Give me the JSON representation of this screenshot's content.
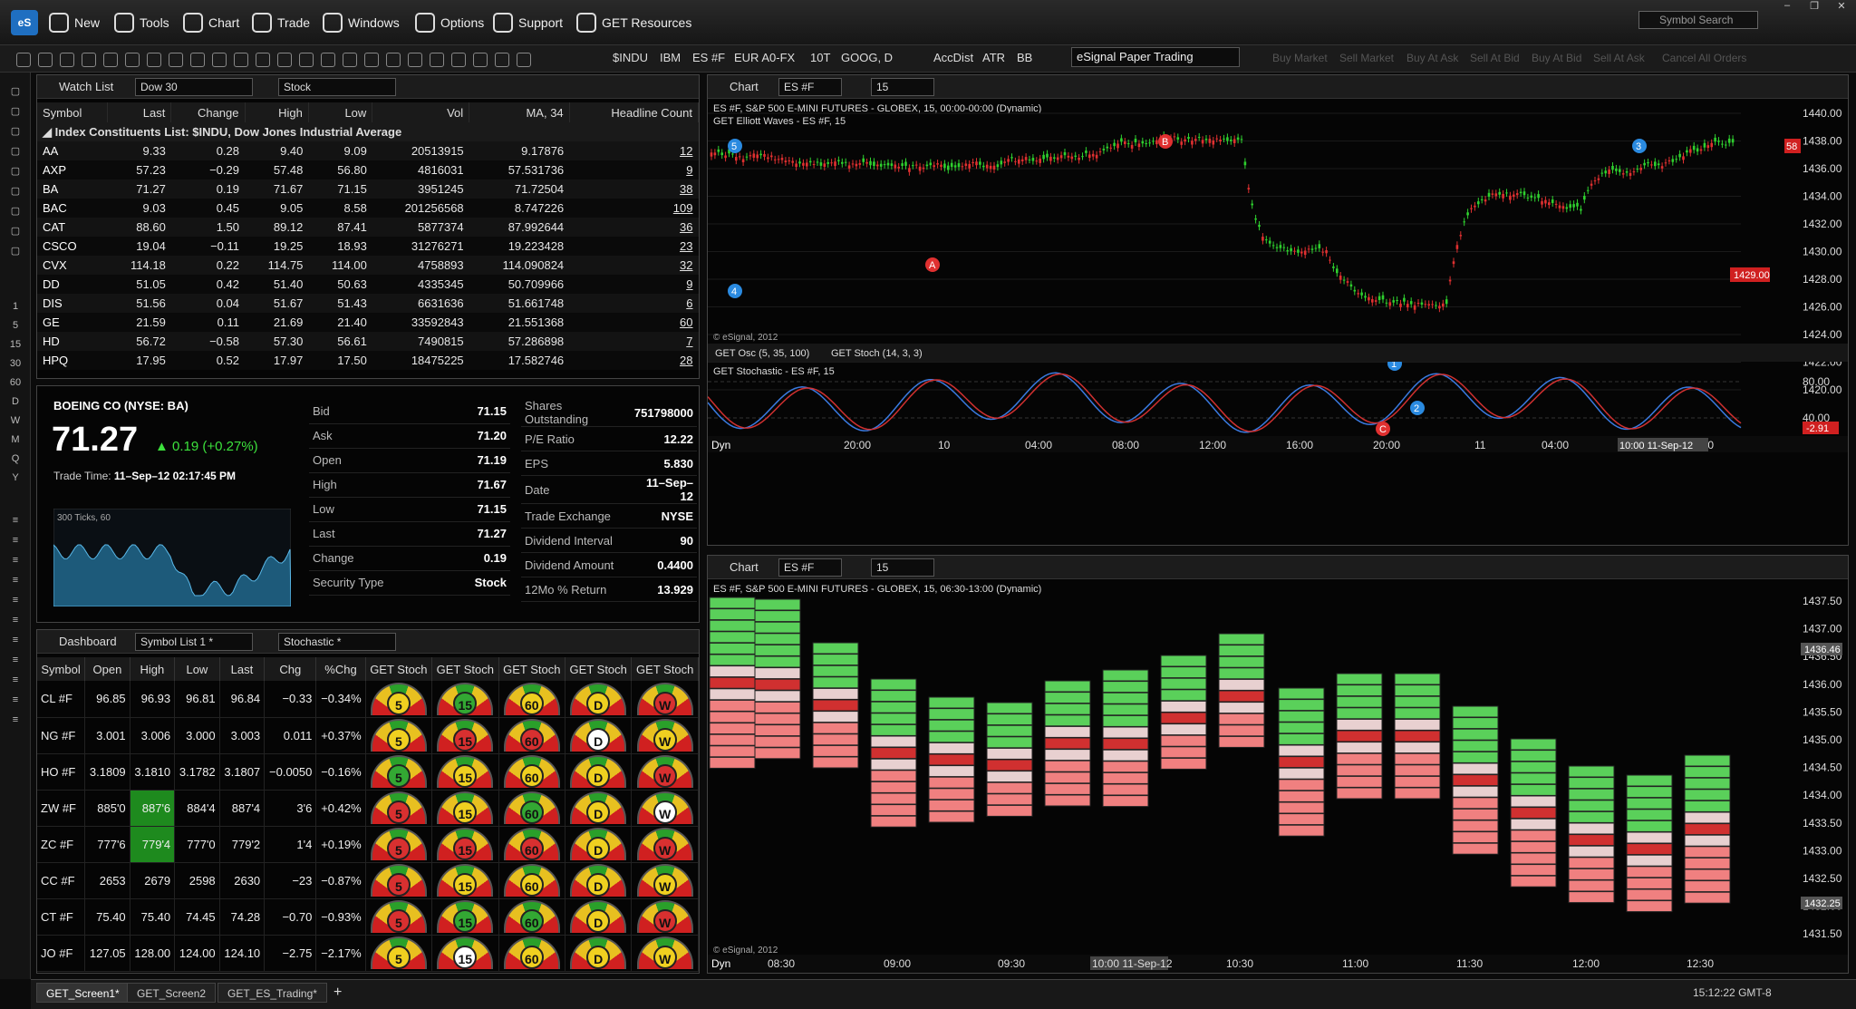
{
  "app": {
    "logo": "eS",
    "menu": [
      {
        "label": "New",
        "icon": "new-icon"
      },
      {
        "label": "Tools",
        "icon": "tools-icon"
      },
      {
        "label": "Chart",
        "icon": "chart-icon"
      },
      {
        "label": "Trade",
        "icon": "trade-icon"
      },
      {
        "label": "Windows",
        "icon": "windows-icon"
      },
      {
        "label": "Options",
        "icon": "gear-icon"
      },
      {
        "label": "Support",
        "icon": "help-icon"
      },
      {
        "label": "GET Resources",
        "icon": "get-icon"
      }
    ],
    "symbol_search_placeholder": "Symbol Search"
  },
  "toolbar": {
    "symbols": [
      "$INDU",
      "IBM",
      "ES #F",
      "EUR A0-FX",
      "10T",
      "GOOG, D"
    ],
    "studies": [
      "AccDist",
      "ATR",
      "BB"
    ],
    "account": "eSignal Paper Trading",
    "order_buttons": [
      "Buy Market",
      "Sell Market",
      "Buy At Ask",
      "Sell At Bid",
      "Buy At Bid",
      "Sell At Ask",
      "Cancel All Orders"
    ]
  },
  "left_strip": [
    "1",
    "5",
    "15",
    "30",
    "60",
    "D",
    "W",
    "M",
    "Q",
    "Y"
  ],
  "watchlist": {
    "title": "Watch List",
    "list": "Dow 30",
    "type": "Stock",
    "headers": [
      "Symbol",
      "Last",
      "Change",
      "High",
      "Low",
      "Vol",
      "MA, 34",
      "Headline Count"
    ],
    "group": "Index Constituents List: $INDU, Dow Jones Industrial Average",
    "rows": [
      [
        "AA",
        "9.33",
        "0.28",
        "9.40",
        "9.09",
        "20513915",
        "9.17876",
        "12"
      ],
      [
        "AXP",
        "57.23",
        "−0.29",
        "57.48",
        "56.80",
        "4816031",
        "57.531736",
        "9"
      ],
      [
        "BA",
        "71.27",
        "0.19",
        "71.67",
        "71.15",
        "3951245",
        "71.72504",
        "38"
      ],
      [
        "BAC",
        "9.03",
        "0.45",
        "9.05",
        "8.58",
        "201256568",
        "8.747226",
        "109"
      ],
      [
        "CAT",
        "88.60",
        "1.50",
        "89.12",
        "87.41",
        "5877374",
        "87.992644",
        "36"
      ],
      [
        "CSCO",
        "19.04",
        "−0.11",
        "19.25",
        "18.93",
        "31276271",
        "19.223428",
        "23"
      ],
      [
        "CVX",
        "114.18",
        "0.22",
        "114.75",
        "114.00",
        "4758893",
        "114.090824",
        "32"
      ],
      [
        "DD",
        "51.05",
        "0.42",
        "51.40",
        "50.63",
        "4335345",
        "50.709966",
        "9"
      ],
      [
        "DIS",
        "51.56",
        "0.04",
        "51.67",
        "51.43",
        "6631636",
        "51.661748",
        "6"
      ],
      [
        "GE",
        "21.59",
        "0.11",
        "21.69",
        "21.40",
        "33592843",
        "21.551368",
        "60"
      ],
      [
        "HD",
        "56.72",
        "−0.58",
        "57.30",
        "56.61",
        "7490815",
        "57.286898",
        "7"
      ],
      [
        "HPQ",
        "17.95",
        "0.52",
        "17.97",
        "17.50",
        "18475225",
        "17.582746",
        "28"
      ]
    ]
  },
  "quote": {
    "name": "BOEING CO (NYSE: BA)",
    "last": "71.27",
    "change": "0.19 (+0.27%)",
    "trade_time_label": "Trade Time:",
    "trade_time": "11–Sep–12 02:17:45 PM",
    "mini_chart_label": "300 Ticks, 60",
    "left": [
      [
        "Bid",
        "71.15"
      ],
      [
        "Ask",
        "71.20"
      ],
      [
        "Open",
        "71.19"
      ],
      [
        "High",
        "71.67"
      ],
      [
        "Low",
        "71.15"
      ],
      [
        "Last",
        "71.27"
      ],
      [
        "Change",
        "0.19"
      ],
      [
        "Security Type",
        "Stock"
      ]
    ],
    "right": [
      [
        "Shares Outstanding",
        "751798000"
      ],
      [
        "P/E Ratio",
        "12.22"
      ],
      [
        "EPS",
        "5.830"
      ],
      [
        "Date",
        "11–Sep–12"
      ],
      [
        "Trade Exchange",
        "NYSE"
      ],
      [
        "Dividend Interval",
        "90"
      ],
      [
        "Dividend Amount",
        "0.4400"
      ],
      [
        "12Mo % Return",
        "13.929"
      ]
    ]
  },
  "dashboard": {
    "title": "Dashboard",
    "list": "Symbol List 1 *",
    "study": "Stochastic *",
    "headers": [
      "Symbol",
      "Open",
      "High",
      "Low",
      "Last",
      "Chg",
      "%Chg",
      "GET Stoch",
      "GET Stoch",
      "GET Stoch",
      "GET Stoch",
      "GET Stoch"
    ],
    "rows": [
      {
        "s": "CL #F",
        "o": "96.85",
        "h": "96.93",
        "l": "96.81",
        "last": "96.84",
        "c": "−0.33",
        "p": "−0.34%",
        "g": [
          "5",
          "15",
          "60",
          "D",
          "W"
        ],
        "gc": [
          "gy",
          "gr",
          "gy",
          "gy",
          "grd"
        ]
      },
      {
        "s": "NG #F",
        "o": "3.001",
        "h": "3.006",
        "l": "3.000",
        "last": "3.003",
        "c": "0.011",
        "p": "+0.37%",
        "g": [
          "5",
          "15",
          "60",
          "D",
          "W"
        ],
        "gc": [
          "gy",
          "grd",
          "grd",
          "gw",
          "gy"
        ]
      },
      {
        "s": "HO #F",
        "o": "3.1809",
        "h": "3.1810",
        "l": "3.1782",
        "last": "3.1807",
        "c": "−0.0050",
        "p": "−0.16%",
        "g": [
          "5",
          "15",
          "60",
          "D",
          "W"
        ],
        "gc": [
          "gr",
          "gy",
          "gy",
          "gy",
          "grd"
        ]
      },
      {
        "s": "ZW #F",
        "o": "885'0",
        "h": "887'6",
        "l": "884'4",
        "last": "887'4",
        "c": "3'6",
        "p": "+0.42%",
        "g": [
          "5",
          "15",
          "60",
          "D",
          "W"
        ],
        "gc": [
          "grd",
          "gy",
          "gr",
          "gy",
          "gw"
        ]
      },
      {
        "s": "ZC #F",
        "o": "777'6",
        "h": "779'4",
        "l": "777'0",
        "last": "779'2",
        "c": "1'4",
        "p": "+0.19%",
        "g": [
          "5",
          "15",
          "60",
          "D",
          "W"
        ],
        "gc": [
          "grd",
          "grd",
          "grd",
          "gy",
          "grd"
        ]
      },
      {
        "s": "CC #F",
        "o": "2653",
        "h": "2679",
        "l": "2598",
        "last": "2630",
        "c": "−23",
        "p": "−0.87%",
        "g": [
          "5",
          "15",
          "60",
          "D",
          "W"
        ],
        "gc": [
          "grd",
          "gy",
          "gy",
          "gy",
          "gy"
        ]
      },
      {
        "s": "CT #F",
        "o": "75.40",
        "h": "75.40",
        "l": "74.45",
        "last": "74.28",
        "c": "−0.70",
        "p": "−0.93%",
        "g": [
          "5",
          "15",
          "60",
          "D",
          "W"
        ],
        "gc": [
          "grd",
          "gr",
          "gr",
          "gy",
          "grd"
        ]
      },
      {
        "s": "JO #F",
        "o": "127.05",
        "h": "128.00",
        "l": "124.00",
        "last": "124.10",
        "c": "−2.75",
        "p": "−2.17%",
        "g": [
          "5",
          "15",
          "60",
          "D",
          "W"
        ],
        "gc": [
          "gy",
          "gw",
          "gy",
          "gy",
          "gy"
        ]
      }
    ]
  },
  "chart1": {
    "title": "Chart",
    "symbol": "ES #F",
    "interval": "15",
    "desc": "ES #F, S&P 500 E-MINI FUTURES - GLOBEX, 15, 00:00-00:00 (Dynamic)",
    "study": "GET Elliott Waves - ES #F, 15",
    "copyright": "© eSignal, 2012",
    "price_labels": [
      "1440.00",
      "1438.00",
      "1436.00",
      "1434.00",
      "1432.00",
      "1430.00",
      "1428.00",
      "1426.00",
      "1424.00",
      "1422.00",
      "1420.00"
    ],
    "last_price": "1429.00",
    "tag": "58",
    "tabs": [
      "GET Osc (5, 35, 100)",
      "GET Stoch (14, 3, 3)"
    ],
    "osc_title": "GET Stochastic - ES #F, 15",
    "osc_labels": [
      "80.00",
      "40.00"
    ],
    "osc_last": "-2.91",
    "time_labels": [
      "20:00",
      "10",
      "04:00",
      "08:00",
      "12:00",
      "16:00",
      "20:00",
      "11",
      "04:00",
      "08:00",
      "12:00"
    ],
    "time_highlight": "10:00 11-Sep-12",
    "dyn": "Dyn"
  },
  "chart2": {
    "title": "Chart",
    "symbol": "ES #F",
    "interval": "15",
    "desc": "ES #F, S&P 500 E-MINI FUTURES - GLOBEX, 15, 06:30-13:00 (Dynamic)",
    "copyright": "© eSignal, 2012",
    "price_labels": [
      "1437.50",
      "1437.00",
      "1436.50",
      "1436.00",
      "1435.50",
      "1435.00",
      "1434.50",
      "1434.00",
      "1433.50",
      "1433.00",
      "1432.50",
      "1432.00",
      "1431.50"
    ],
    "last_price": "1436.46",
    "last_price2": "1432.25",
    "time_labels": [
      "08:30",
      "09:00",
      "09:30",
      "10:00 11-Sep-12",
      "10:30",
      "11:00",
      "11:30",
      "12:00",
      "12:30"
    ],
    "dyn": "Dyn"
  },
  "bottom_tabs": [
    "GET_Screen1*",
    "GET_Screen2",
    "GET_ES_Trading*"
  ],
  "status": {
    "time": "15:12:22",
    "tz": "GMT-8"
  }
}
